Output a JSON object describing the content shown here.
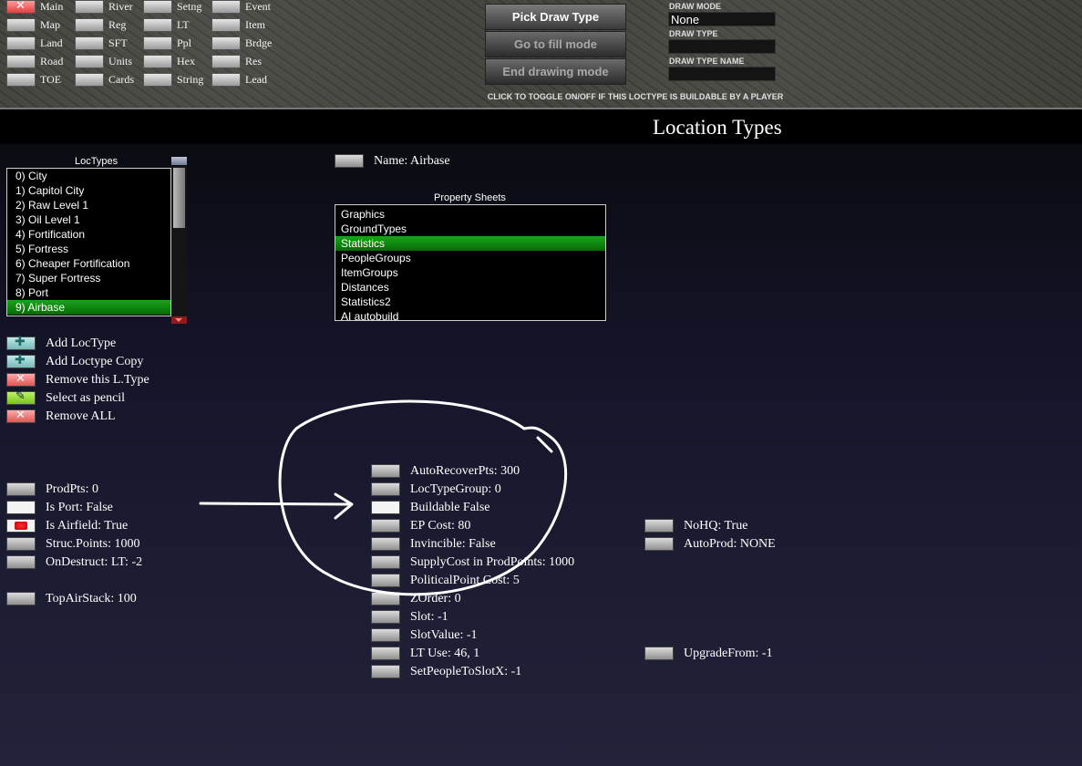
{
  "toolbar": {
    "columns": [
      [
        "Main",
        "Map",
        "Land",
        "Road",
        "TOE"
      ],
      [
        "River",
        "Reg",
        "SFT",
        "Units",
        "Cards"
      ],
      [
        "Setng",
        "LT",
        "Ppl",
        "Hex",
        "String"
      ],
      [
        "Event",
        "Item",
        "Brdge",
        "Res",
        "Lead"
      ]
    ],
    "pick_draw_type": "Pick Draw Type",
    "go_fill_mode": "Go to fill mode",
    "end_drawing_mode": "End drawing mode",
    "draw_mode_label": "DRAW MODE",
    "draw_mode_value": "None",
    "draw_type_label": "DRAW TYPE",
    "draw_type_value": "",
    "draw_type_name_label": "DRAW TYPE NAME",
    "draw_type_name_value": "",
    "hint": "CLICK TO TOGGLE ON/OFF IF THIS LOCTYPE IS BUILDABLE BY A PLAYER"
  },
  "page_title": "Location Types",
  "loctypes": {
    "caption": "LocTypes",
    "items": [
      "0) City",
      "1) Capitol City",
      "2) Raw Level 1",
      "3) Oil Level 1",
      "4) Fortification",
      "5) Fortress",
      "6) Cheaper Fortification",
      "7) Super Fortress",
      "8) Port",
      "9) Airbase"
    ],
    "selected": "9) Airbase"
  },
  "name_field": "Name: Airbase",
  "property_sheets": {
    "caption": "Property Sheets",
    "items": [
      "Graphics",
      "GroundTypes",
      "Statistics",
      "PeopleGroups",
      "ItemGroups",
      "Distances",
      "Statistics2",
      "AI autobuild"
    ],
    "selected": "Statistics"
  },
  "actions": [
    "Add LocType",
    "Add Loctype Copy",
    "Remove this L.Type",
    "Select as pencil",
    "Remove ALL"
  ],
  "left_props": [
    "ProdPts:  0",
    "Is Port: False",
    "Is Airfield: True",
    "Struc.Points:  1000",
    "OnDestruct: LT: -2",
    "TopAirStack:  100"
  ],
  "mid_props": [
    "AutoRecoverPts:  300",
    "LocTypeGroup:  0",
    "Buildable False",
    "EP Cost:  80",
    "Invincible: False",
    "SupplyCost in ProdPoints:  1000",
    "PoliticalPoint Cost:  5",
    "ZOrder:  0",
    "Slot: -1",
    "SlotValue: -1",
    "LT Use:  46, 1",
    "SetPeopleToSlotX: -1"
  ],
  "right_props": [
    "NoHQ: True",
    "AutoProd: NONE",
    "UpgradeFrom: -1"
  ],
  "colors": {
    "selection": "#0c8a0c",
    "accent_red": "#e05555"
  }
}
